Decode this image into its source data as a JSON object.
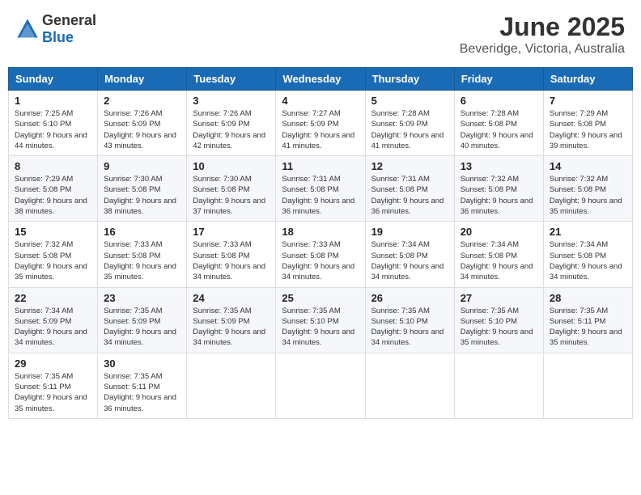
{
  "header": {
    "logo_general": "General",
    "logo_blue": "Blue",
    "month_title": "June 2025",
    "location": "Beveridge, Victoria, Australia"
  },
  "weekdays": [
    "Sunday",
    "Monday",
    "Tuesday",
    "Wednesday",
    "Thursday",
    "Friday",
    "Saturday"
  ],
  "weeks": [
    [
      {
        "day": "1",
        "sunrise": "Sunrise: 7:25 AM",
        "sunset": "Sunset: 5:10 PM",
        "daylight": "Daylight: 9 hours and 44 minutes."
      },
      {
        "day": "2",
        "sunrise": "Sunrise: 7:26 AM",
        "sunset": "Sunset: 5:09 PM",
        "daylight": "Daylight: 9 hours and 43 minutes."
      },
      {
        "day": "3",
        "sunrise": "Sunrise: 7:26 AM",
        "sunset": "Sunset: 5:09 PM",
        "daylight": "Daylight: 9 hours and 42 minutes."
      },
      {
        "day": "4",
        "sunrise": "Sunrise: 7:27 AM",
        "sunset": "Sunset: 5:09 PM",
        "daylight": "Daylight: 9 hours and 41 minutes."
      },
      {
        "day": "5",
        "sunrise": "Sunrise: 7:28 AM",
        "sunset": "Sunset: 5:09 PM",
        "daylight": "Daylight: 9 hours and 41 minutes."
      },
      {
        "day": "6",
        "sunrise": "Sunrise: 7:28 AM",
        "sunset": "Sunset: 5:08 PM",
        "daylight": "Daylight: 9 hours and 40 minutes."
      },
      {
        "day": "7",
        "sunrise": "Sunrise: 7:29 AM",
        "sunset": "Sunset: 5:08 PM",
        "daylight": "Daylight: 9 hours and 39 minutes."
      }
    ],
    [
      {
        "day": "8",
        "sunrise": "Sunrise: 7:29 AM",
        "sunset": "Sunset: 5:08 PM",
        "daylight": "Daylight: 9 hours and 38 minutes."
      },
      {
        "day": "9",
        "sunrise": "Sunrise: 7:30 AM",
        "sunset": "Sunset: 5:08 PM",
        "daylight": "Daylight: 9 hours and 38 minutes."
      },
      {
        "day": "10",
        "sunrise": "Sunrise: 7:30 AM",
        "sunset": "Sunset: 5:08 PM",
        "daylight": "Daylight: 9 hours and 37 minutes."
      },
      {
        "day": "11",
        "sunrise": "Sunrise: 7:31 AM",
        "sunset": "Sunset: 5:08 PM",
        "daylight": "Daylight: 9 hours and 36 minutes."
      },
      {
        "day": "12",
        "sunrise": "Sunrise: 7:31 AM",
        "sunset": "Sunset: 5:08 PM",
        "daylight": "Daylight: 9 hours and 36 minutes."
      },
      {
        "day": "13",
        "sunrise": "Sunrise: 7:32 AM",
        "sunset": "Sunset: 5:08 PM",
        "daylight": "Daylight: 9 hours and 36 minutes."
      },
      {
        "day": "14",
        "sunrise": "Sunrise: 7:32 AM",
        "sunset": "Sunset: 5:08 PM",
        "daylight": "Daylight: 9 hours and 35 minutes."
      }
    ],
    [
      {
        "day": "15",
        "sunrise": "Sunrise: 7:32 AM",
        "sunset": "Sunset: 5:08 PM",
        "daylight": "Daylight: 9 hours and 35 minutes."
      },
      {
        "day": "16",
        "sunrise": "Sunrise: 7:33 AM",
        "sunset": "Sunset: 5:08 PM",
        "daylight": "Daylight: 9 hours and 35 minutes."
      },
      {
        "day": "17",
        "sunrise": "Sunrise: 7:33 AM",
        "sunset": "Sunset: 5:08 PM",
        "daylight": "Daylight: 9 hours and 34 minutes."
      },
      {
        "day": "18",
        "sunrise": "Sunrise: 7:33 AM",
        "sunset": "Sunset: 5:08 PM",
        "daylight": "Daylight: 9 hours and 34 minutes."
      },
      {
        "day": "19",
        "sunrise": "Sunrise: 7:34 AM",
        "sunset": "Sunset: 5:08 PM",
        "daylight": "Daylight: 9 hours and 34 minutes."
      },
      {
        "day": "20",
        "sunrise": "Sunrise: 7:34 AM",
        "sunset": "Sunset: 5:08 PM",
        "daylight": "Daylight: 9 hours and 34 minutes."
      },
      {
        "day": "21",
        "sunrise": "Sunrise: 7:34 AM",
        "sunset": "Sunset: 5:08 PM",
        "daylight": "Daylight: 9 hours and 34 minutes."
      }
    ],
    [
      {
        "day": "22",
        "sunrise": "Sunrise: 7:34 AM",
        "sunset": "Sunset: 5:09 PM",
        "daylight": "Daylight: 9 hours and 34 minutes."
      },
      {
        "day": "23",
        "sunrise": "Sunrise: 7:35 AM",
        "sunset": "Sunset: 5:09 PM",
        "daylight": "Daylight: 9 hours and 34 minutes."
      },
      {
        "day": "24",
        "sunrise": "Sunrise: 7:35 AM",
        "sunset": "Sunset: 5:09 PM",
        "daylight": "Daylight: 9 hours and 34 minutes."
      },
      {
        "day": "25",
        "sunrise": "Sunrise: 7:35 AM",
        "sunset": "Sunset: 5:10 PM",
        "daylight": "Daylight: 9 hours and 34 minutes."
      },
      {
        "day": "26",
        "sunrise": "Sunrise: 7:35 AM",
        "sunset": "Sunset: 5:10 PM",
        "daylight": "Daylight: 9 hours and 34 minutes."
      },
      {
        "day": "27",
        "sunrise": "Sunrise: 7:35 AM",
        "sunset": "Sunset: 5:10 PM",
        "daylight": "Daylight: 9 hours and 35 minutes."
      },
      {
        "day": "28",
        "sunrise": "Sunrise: 7:35 AM",
        "sunset": "Sunset: 5:11 PM",
        "daylight": "Daylight: 9 hours and 35 minutes."
      }
    ],
    [
      {
        "day": "29",
        "sunrise": "Sunrise: 7:35 AM",
        "sunset": "Sunset: 5:11 PM",
        "daylight": "Daylight: 9 hours and 35 minutes."
      },
      {
        "day": "30",
        "sunrise": "Sunrise: 7:35 AM",
        "sunset": "Sunset: 5:11 PM",
        "daylight": "Daylight: 9 hours and 36 minutes."
      },
      null,
      null,
      null,
      null,
      null
    ]
  ]
}
